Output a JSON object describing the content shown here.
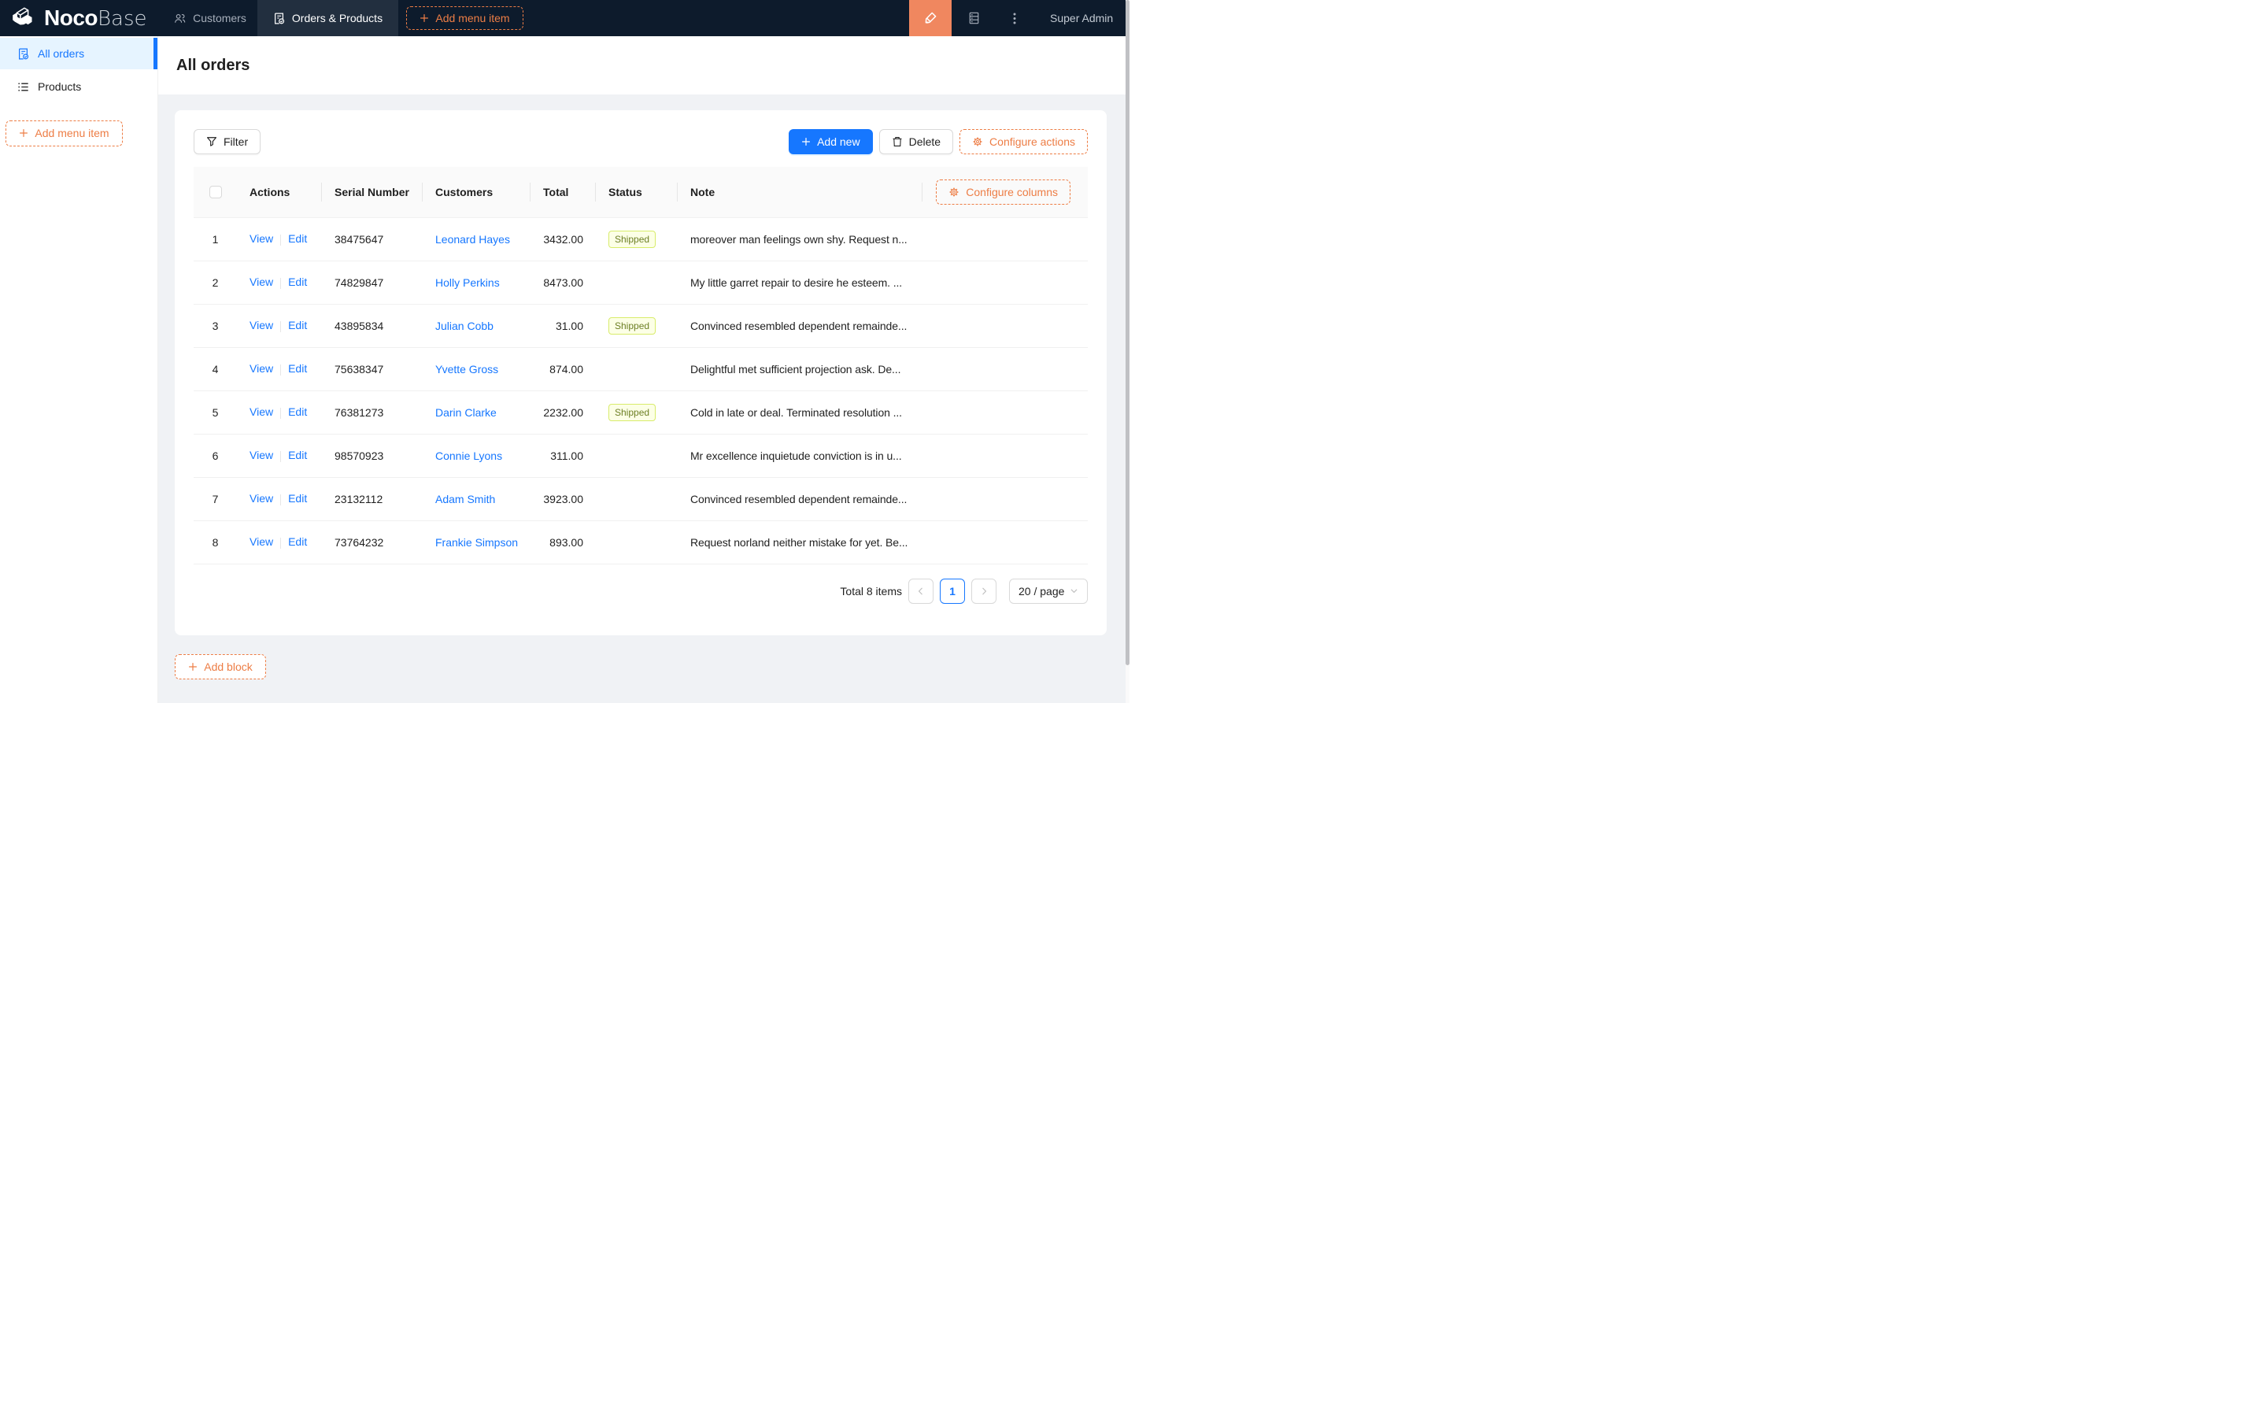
{
  "navbar": {
    "logo": {
      "bold": "Noco",
      "light": "Base"
    },
    "tabs": [
      {
        "label": "Customers"
      },
      {
        "label": "Orders & Products"
      }
    ],
    "add_menu_item_label": "Add menu item",
    "user": "Super Admin"
  },
  "sidebar": {
    "items": [
      {
        "label": "All orders"
      },
      {
        "label": "Products"
      }
    ],
    "add_menu_item_label": "Add menu item"
  },
  "page": {
    "title": "All orders"
  },
  "toolbar": {
    "filter_label": "Filter",
    "add_new_label": "Add new",
    "delete_label": "Delete",
    "configure_actions_label": "Configure actions"
  },
  "table": {
    "columns": {
      "actions": "Actions",
      "serial": "Serial Number",
      "customers": "Customers",
      "total": "Total",
      "status": "Status",
      "note": "Note"
    },
    "configure_columns_label": "Configure columns",
    "view_label": "View",
    "edit_label": "Edit",
    "rows": [
      {
        "index": "1",
        "serial": "38475647",
        "customer": "Leonard Hayes",
        "total": "3432.00",
        "status": "Shipped",
        "note": "moreover man feelings own shy. Request n..."
      },
      {
        "index": "2",
        "serial": "74829847",
        "customer": "Holly Perkins",
        "total": "8473.00",
        "status": "",
        "note": "My little garret repair to desire he esteem. ..."
      },
      {
        "index": "3",
        "serial": "43895834",
        "customer": "Julian Cobb",
        "total": "31.00",
        "status": "Shipped",
        "note": "Convinced resembled dependent remainde..."
      },
      {
        "index": "4",
        "serial": "75638347",
        "customer": "Yvette Gross",
        "total": "874.00",
        "status": "",
        "note": "Delightful met sufficient projection ask. De..."
      },
      {
        "index": "5",
        "serial": "76381273",
        "customer": "Darin Clarke",
        "total": "2232.00",
        "status": "Shipped",
        "note": "Cold in late or deal. Terminated resolution ..."
      },
      {
        "index": "6",
        "serial": "98570923",
        "customer": "Connie Lyons",
        "total": "311.00",
        "status": "",
        "note": "Mr excellence inquietude conviction is in u..."
      },
      {
        "index": "7",
        "serial": "23132112",
        "customer": "Adam Smith",
        "total": "3923.00",
        "status": "",
        "note": "Convinced resembled dependent remainde..."
      },
      {
        "index": "8",
        "serial": "73764232",
        "customer": "Frankie Simpson",
        "total": "893.00",
        "status": "",
        "note": "Request norland neither mistake for yet. Be..."
      }
    ]
  },
  "pagination": {
    "total_text": "Total 8 items",
    "current_page": "1",
    "page_size": "20 / page"
  },
  "add_block_label": "Add block",
  "colors": {
    "primary": "#1677ff",
    "designable_orange": "#ed7d45",
    "navbar_bg": "#0d1b2c",
    "tag_bg": "#fcffe6",
    "tag_border": "#d8ec6a",
    "tag_text": "#6d7f25",
    "sidebar_active_bg": "#e6f4ff"
  }
}
